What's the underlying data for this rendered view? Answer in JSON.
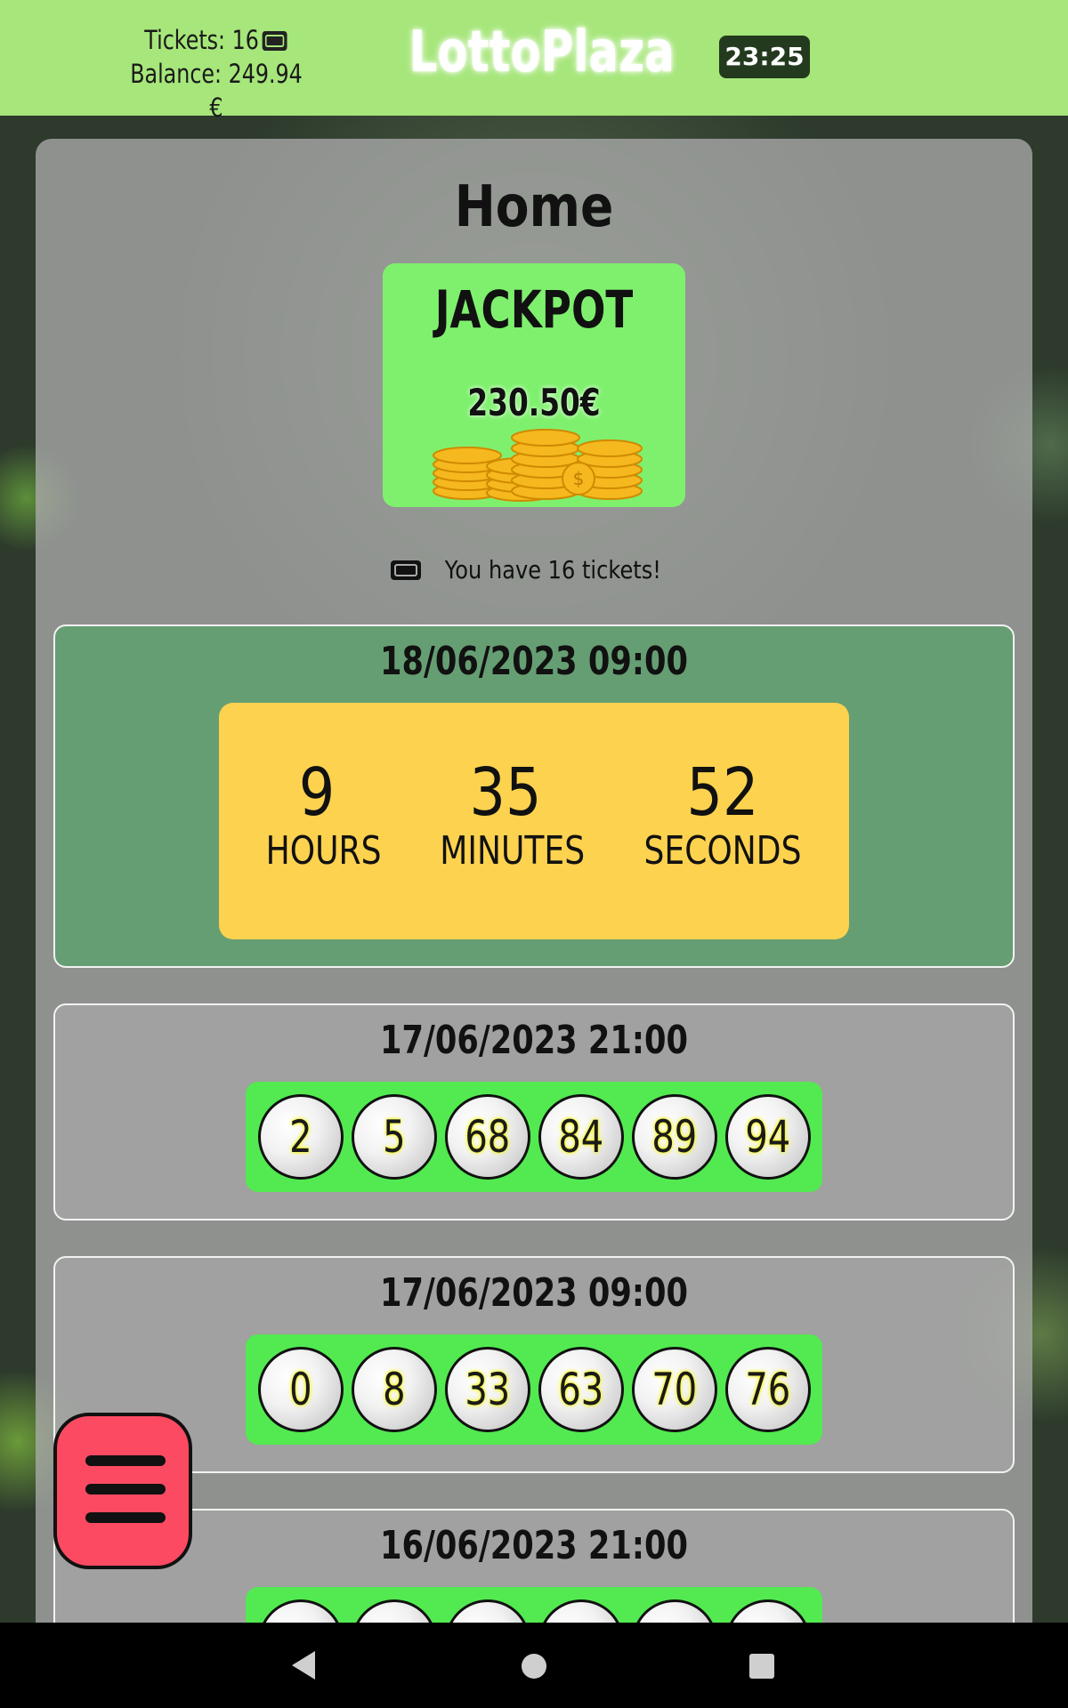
{
  "header": {
    "tickets_label": "Tickets: 16",
    "balance_label": "Balance: 249.94 €",
    "brand": "LottoPlaza",
    "clock": "23:25"
  },
  "page": {
    "title": "Home"
  },
  "jackpot": {
    "label": "JACKPOT",
    "amount": "230.50€"
  },
  "tickets_note": "You have 16 tickets!",
  "next_draw": {
    "date": "18/06/2023 09:00",
    "hours": "9",
    "hours_label": "HOURS",
    "minutes": "35",
    "minutes_label": "MINUTES",
    "seconds": "52",
    "seconds_label": "SECONDS"
  },
  "past_draws": [
    {
      "date": "17/06/2023 21:00",
      "numbers": [
        "2",
        "5",
        "68",
        "84",
        "89",
        "94"
      ]
    },
    {
      "date": "17/06/2023 09:00",
      "numbers": [
        "0",
        "8",
        "33",
        "63",
        "70",
        "76"
      ]
    },
    {
      "date": "16/06/2023 21:00",
      "numbers": [
        "",
        "",
        "",
        "",
        "",
        ""
      ]
    }
  ],
  "icons": {
    "ticket": "ticket-icon",
    "menu": "hamburger-menu-icon",
    "coins": "coins-icon",
    "nav_back": "back-triangle-icon",
    "nav_home": "home-circle-icon",
    "nav_recent": "recent-apps-square-icon"
  },
  "colors": {
    "topbar": "#a6e67a",
    "jackpot_card": "#7ff06e",
    "next_draw_card": "#669e73",
    "countdown": "#fdd24f",
    "balls_strip": "#52ea50",
    "menu_button": "#fb4a62"
  }
}
